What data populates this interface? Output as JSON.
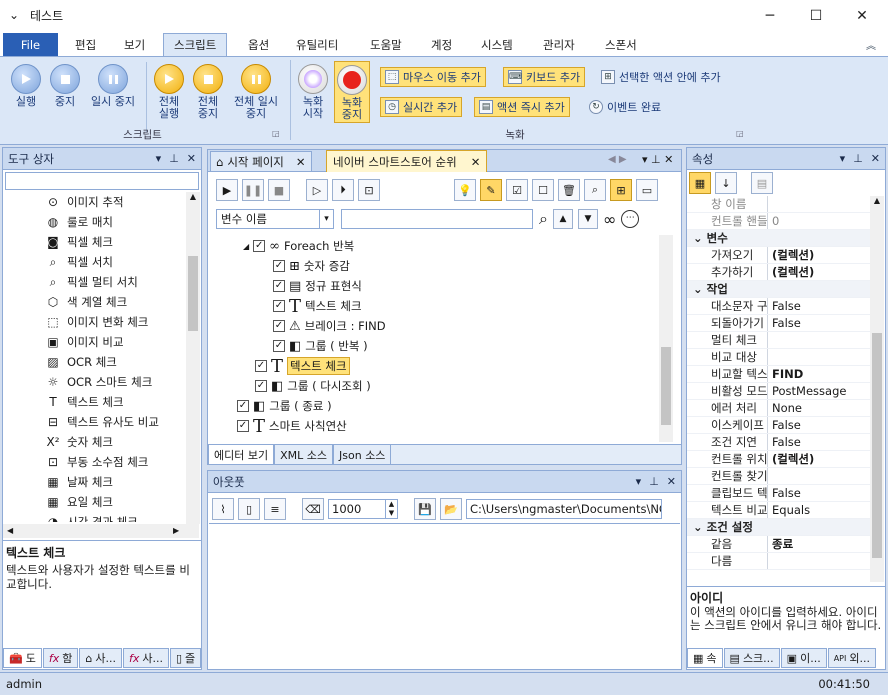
{
  "window": {
    "title": "테스트",
    "controls": [
      "─",
      "☐",
      "✕"
    ]
  },
  "ribbon_tabs": [
    "File",
    "편집",
    "보기",
    "스크립트",
    "옵션",
    "유틸리티",
    "도움말",
    "계정",
    "시스템",
    "관리자",
    "스폰서"
  ],
  "ribbon": {
    "script_group": {
      "label": "스크립트",
      "buttons": [
        "실행",
        "중지",
        "일시 중지"
      ],
      "all_buttons": [
        "전체 실행",
        "전체 중지",
        "전체 일시 중지"
      ]
    },
    "record_group": {
      "label": "녹화",
      "record_start": "녹화 시작",
      "record_stop": "녹화 중지",
      "mouse_move": "마우스 이동 추가",
      "keyboard_add": "키보드 추가",
      "insert_in_selected": "선택한 액션 안에 추가",
      "realtime_add": "실시간 추가",
      "action_instant_add": "액션 즉시 추가",
      "event_done": "이벤트 완료"
    }
  },
  "toolbox": {
    "title": "도구 상자",
    "search_value": "",
    "items": [
      "이미지 추적",
      "룰로 매치",
      "픽셀 체크",
      "픽셀 서치",
      "픽셀 멀티 서치",
      "색 계열 체크",
      "이미지 변화 체크",
      "이미지 비교",
      "OCR 체크",
      "OCR 스마트 체크",
      "텍스트 체크",
      "텍스트 유사도 비교",
      "숫자 체크",
      "부동 소수점 체크",
      "날짜 체크",
      "요일 체크",
      "시간 경과 체크"
    ],
    "icons": [
      "target-icon",
      "ruler-icon",
      "camera-icon",
      "magnifier-icon",
      "magnifier-icon",
      "cube-icon",
      "image-change-icon",
      "image-compare-icon",
      "ocr-icon",
      "bulb-icon",
      "text-icon",
      "text-compare-icon",
      "number-icon",
      "float-icon",
      "calendar-icon",
      "calendar-icon",
      "clock-icon"
    ],
    "desc_title": "텍스트 체크",
    "desc_body": "텍스트와 사용자가 설정한 텍스트를 비교합니다.",
    "bottom_tabs": [
      "도",
      "함",
      "사...",
      "사...",
      "즐"
    ]
  },
  "editor": {
    "tabs": [
      "시작 페이지",
      "네이버 스마트스토어 순위"
    ],
    "variable_select": "변수 이름",
    "variable_input": "",
    "tree": [
      {
        "label": "Foreach 반복",
        "indent": 0
      },
      {
        "label": "숫자 증감",
        "indent": 1
      },
      {
        "label": "정규 표현식",
        "indent": 1
      },
      {
        "label": "텍스트 체크",
        "indent": 1
      },
      {
        "label": "브레이크 : FIND",
        "indent": 1
      },
      {
        "label": "그룹 ( 반복 )",
        "indent": 1
      },
      {
        "label": "텍스트 체크",
        "indent": 0
      },
      {
        "label": "그룹 ( 다시조회 )",
        "indent": 0
      },
      {
        "label": "그룹 ( 종료 )",
        "indent": -1
      },
      {
        "label": "스마트 사칙연산",
        "indent": -1
      }
    ],
    "bottom_tabs": [
      "에디터 보기",
      "XML 소스",
      "Json 소스"
    ]
  },
  "output": {
    "title": "아웃풋",
    "count": "1000",
    "path": "C:\\Users\\ngmaster\\Documents\\NGM"
  },
  "properties": {
    "title": "속성",
    "rows": [
      {
        "k": "창 이름",
        "v": "",
        "cat": false
      },
      {
        "k": "컨트롤 핸들",
        "v": "0",
        "cat": false
      },
      {
        "k": "변수",
        "v": "",
        "cat": true
      },
      {
        "k": "가져오기",
        "v": "(컬렉션)",
        "cat": false,
        "bold": true
      },
      {
        "k": "추가하기",
        "v": "(컬렉션)",
        "cat": false,
        "bold": true
      },
      {
        "k": "작업",
        "v": "",
        "cat": true
      },
      {
        "k": "대소문자 구분",
        "v": "False",
        "cat": false
      },
      {
        "k": "되돌아가기",
        "v": "False",
        "cat": false
      },
      {
        "k": "멀티 체크",
        "v": "",
        "cat": false
      },
      {
        "k": "비교 대상",
        "v": "",
        "cat": false
      },
      {
        "k": "비교할 텍스트",
        "v": "FIND",
        "cat": false,
        "bold": true
      },
      {
        "k": "비활성 모드",
        "v": "PostMessage",
        "cat": false
      },
      {
        "k": "에러 처리",
        "v": "None",
        "cat": false
      },
      {
        "k": "이스케이프",
        "v": "False",
        "cat": false
      },
      {
        "k": "조건 지연",
        "v": "False",
        "cat": false
      },
      {
        "k": "컨트롤 위치",
        "v": "(컬렉션)",
        "cat": false,
        "bold": true
      },
      {
        "k": "컨트롤 찾기",
        "v": "",
        "cat": false
      },
      {
        "k": "클립보드 텍스트",
        "v": "False",
        "cat": false
      },
      {
        "k": "텍스트 비교",
        "v": "Equals",
        "cat": false
      },
      {
        "k": "조건 설정",
        "v": "",
        "cat": true
      },
      {
        "k": "같음",
        "v": "종료",
        "cat": false,
        "bold": true
      },
      {
        "k": "다름",
        "v": "",
        "cat": false
      }
    ],
    "desc_title": "아이디",
    "desc_body": "이 액션의 아이디를 입력하세요. 아이디는 스크립트 안에서 유니크 해야 합니다.",
    "bottom_tabs": [
      "속",
      "스크...",
      "이...",
      "외..."
    ]
  },
  "status": {
    "user": "admin",
    "time": "00:41:50"
  }
}
